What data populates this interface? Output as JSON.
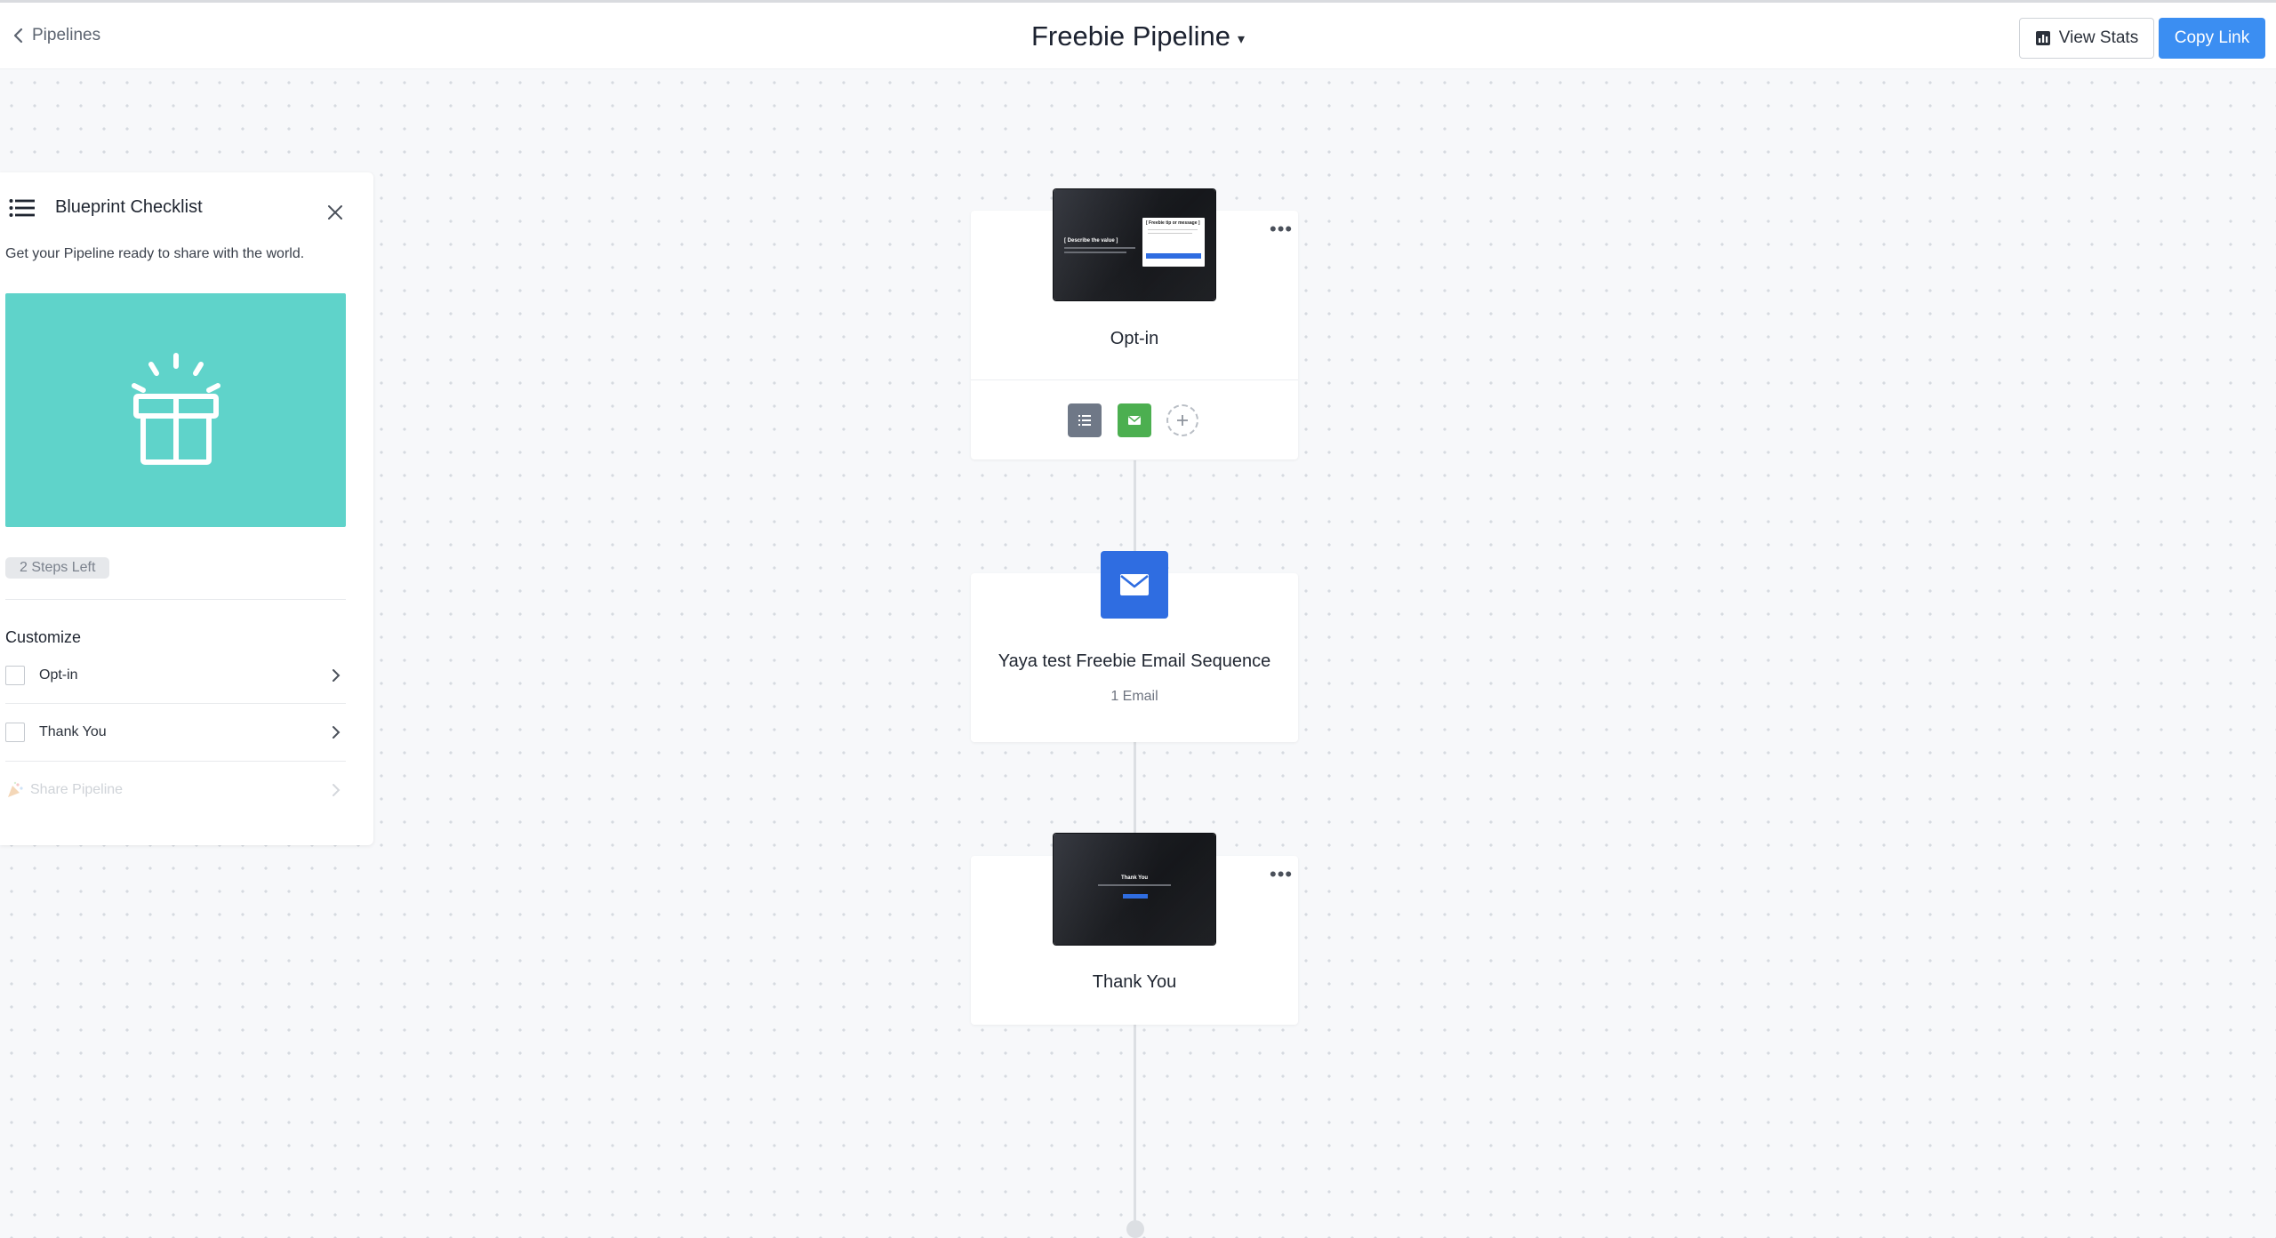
{
  "header": {
    "back_label": "Pipelines",
    "title": "Freebie Pipeline",
    "title_caret": "▾",
    "view_stats_label": "View Stats",
    "copy_link_label": "Copy Link"
  },
  "checklist": {
    "title": "Blueprint Checklist",
    "subtitle": "Get your Pipeline ready to share with the world.",
    "steps_left": "2 Steps Left",
    "section_title": "Customize",
    "items": [
      {
        "label": "Opt-in",
        "checked": false,
        "enabled": true
      },
      {
        "label": "Thank You",
        "checked": false,
        "enabled": true
      },
      {
        "label": "Share Pipeline",
        "checked": false,
        "enabled": false
      }
    ],
    "accent_color": "#5fd3ca"
  },
  "pipeline": {
    "steps": [
      {
        "type": "page",
        "title": "Opt-in",
        "more": "•••",
        "thumbnail_heading": "[ Describe the value ]",
        "thumbnail_modal": "[ Freebie tip or message ]"
      },
      {
        "type": "email_sequence",
        "title": "Yaya test Freebie Email Sequence",
        "meta": "1 Email"
      },
      {
        "type": "page",
        "title": "Thank You",
        "more": "•••",
        "thumbnail_heading": "Thank You"
      }
    ],
    "action_colors": {
      "list": "#6f7887",
      "email": "#4caf50",
      "email_tile": "#2f6de1"
    }
  },
  "colors": {
    "primary": "#3b8ef2",
    "background": "#f7f8fa"
  }
}
